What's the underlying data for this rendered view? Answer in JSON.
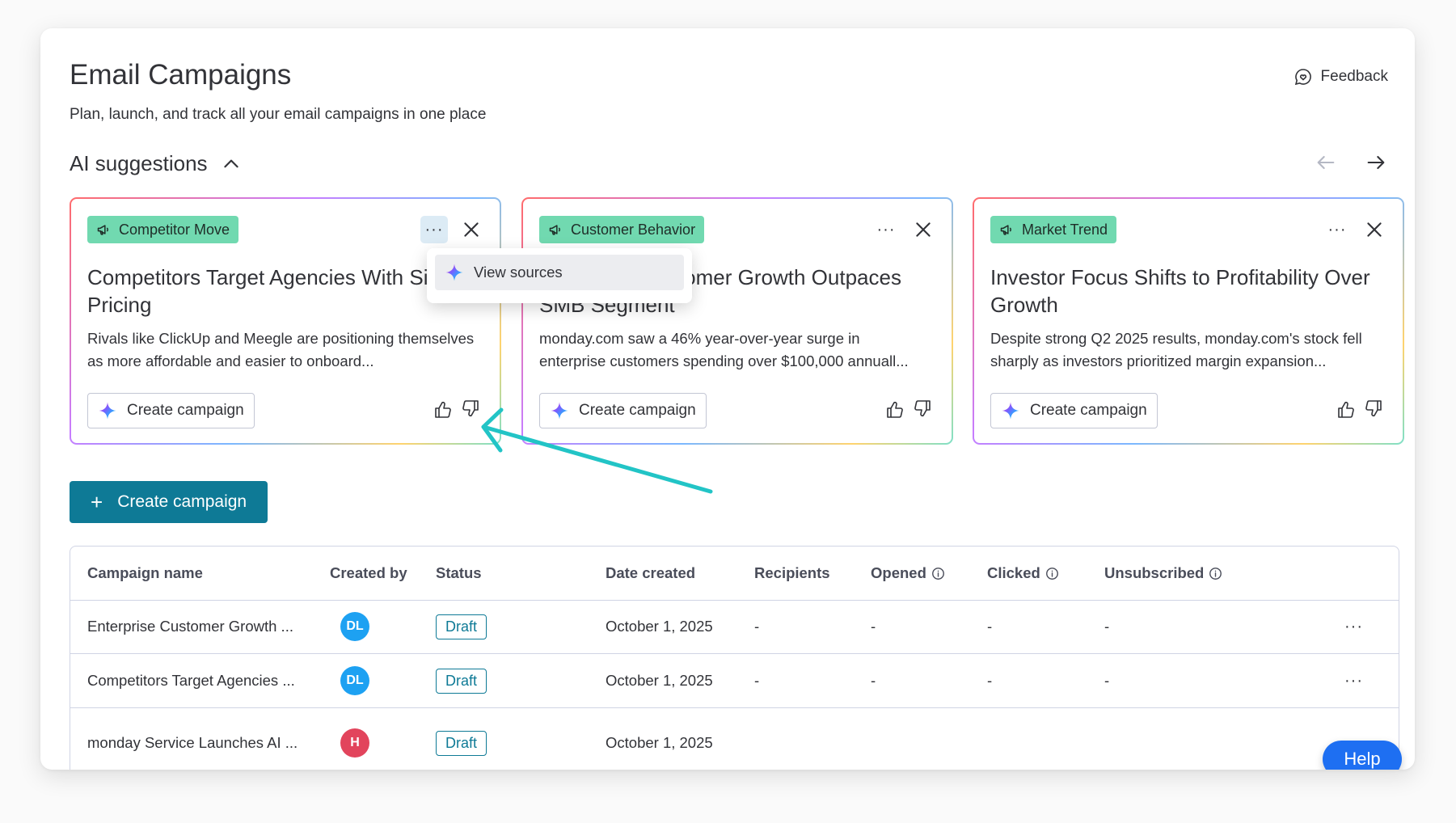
{
  "header": {
    "title": "Email Campaigns",
    "subtitle": "Plan, launch, and track all your email campaigns in one place",
    "feedback_label": "Feedback"
  },
  "ai": {
    "heading": "AI suggestions",
    "cards": [
      {
        "tag": "Competitor Move",
        "title": "Competitors Target Agencies With Simpler Pricing",
        "desc": "Rivals like ClickUp and Meegle are positioning themselves as more affordable and easier to onboard...",
        "create_label": "Create campaign",
        "more": "···"
      },
      {
        "tag": "Customer Behavior",
        "title": "Enterprise Customer Growth Outpaces SMB Segment",
        "desc": "monday.com saw a 46% year-over-year surge in enterprise customers spending over $100,000 annuall...",
        "create_label": "Create campaign",
        "more": "···"
      },
      {
        "tag": "Market Trend",
        "title": "Investor Focus Shifts to Profitability Over Growth",
        "desc": "Despite strong Q2 2025 results, monday.com's stock fell sharply as investors prioritized margin expansion...",
        "create_label": "Create campaign",
        "more": "···"
      }
    ],
    "dropdown_item": "View sources"
  },
  "primary_button": {
    "plus": "+",
    "label": "Create campaign"
  },
  "table": {
    "columns": [
      "Campaign name",
      "Created by",
      "Status",
      "Date created",
      "Recipients",
      "Opened",
      "Clicked",
      "Unsubscribed"
    ],
    "rows": [
      {
        "name": "Enterprise Customer Growth ...",
        "avatar": "DL",
        "status": "Draft",
        "date": "October 1, 2025",
        "recipients": "-",
        "opened": "-",
        "clicked": "-",
        "unsubscribed": "-",
        "more": "···"
      },
      {
        "name": "Competitors Target Agencies ...",
        "avatar": "DL",
        "status": "Draft",
        "date": "October 1, 2025",
        "recipients": "-",
        "opened": "-",
        "clicked": "-",
        "unsubscribed": "-",
        "more": "···"
      },
      {
        "name": "monday Service Launches AI ...",
        "avatar": "H",
        "status": "Draft",
        "date": "October 1, 2025"
      }
    ]
  },
  "help_label": "Help",
  "colors": {
    "accent": "#0e7a96",
    "tag_bg": "#71d9b0",
    "avatar_blue": "#1da1f2",
    "avatar_red": "#e2445c",
    "help": "#1e6ff2",
    "pointer_arrow": "#22c4c6"
  },
  "icons": {
    "feedback": "chat-heart-icon",
    "tag": "megaphone-icon",
    "ai": "sparkle-icon",
    "collapse": "chevron-up-icon",
    "prev": "arrow-left-icon",
    "next": "arrow-right-icon",
    "close": "close-icon",
    "like": "thumbs-up-icon",
    "dislike": "thumbs-down-icon",
    "info": "info-icon"
  }
}
